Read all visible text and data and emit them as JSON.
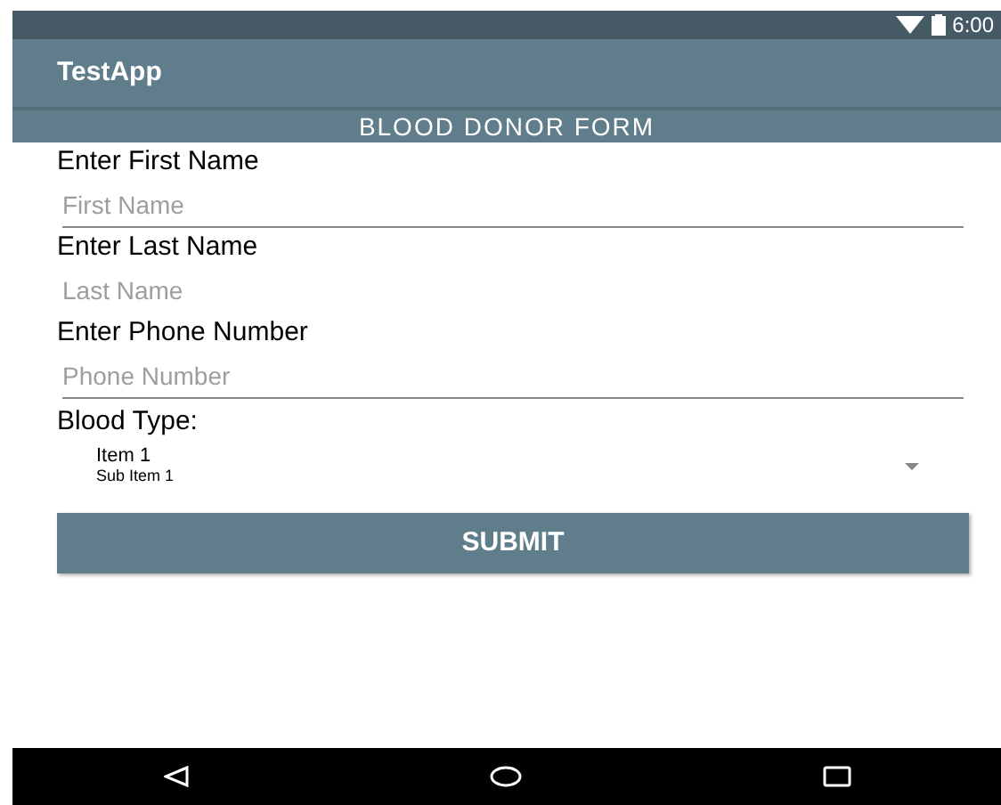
{
  "status_bar": {
    "time": "6:00"
  },
  "app_bar": {
    "title": "TestApp"
  },
  "form": {
    "title": "BLOOD DONOR FORM",
    "fields": [
      {
        "label": "Enter First Name",
        "placeholder": "First Name",
        "underlined": true
      },
      {
        "label": "Enter Last Name",
        "placeholder": "Last Name",
        "underlined": false
      },
      {
        "label": "Enter Phone Number",
        "placeholder": "Phone Number",
        "underlined": true
      }
    ],
    "blood_type": {
      "label": "Blood Type:",
      "item": "Item 1",
      "sub_item": "Sub Item 1"
    },
    "submit": "SUBMIT"
  }
}
